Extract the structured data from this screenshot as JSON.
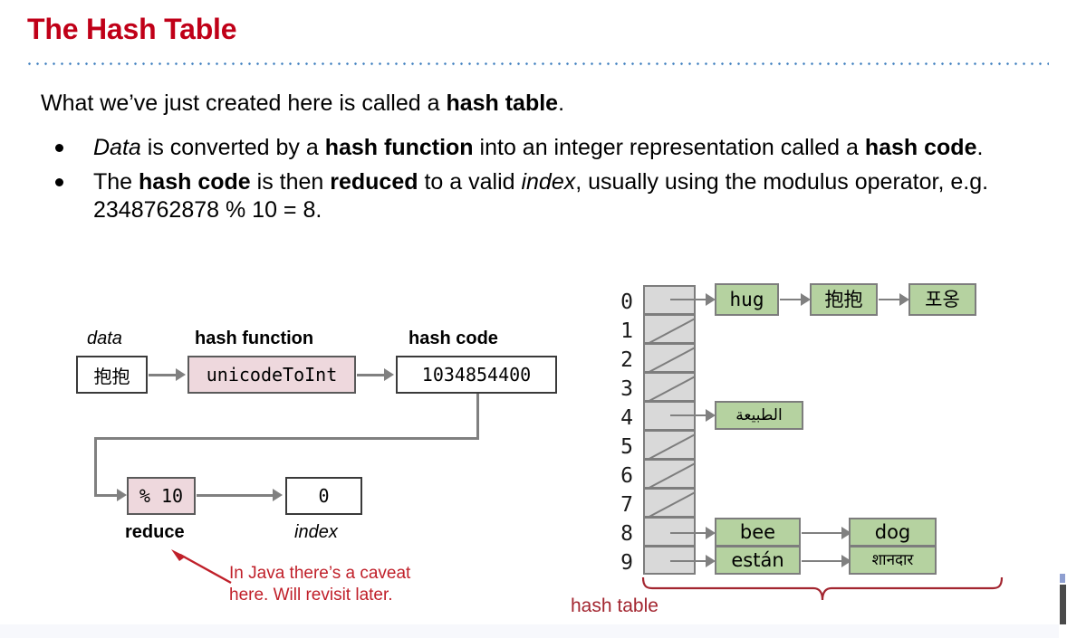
{
  "slide": {
    "title": "The Hash Table",
    "lead": {
      "pre": "What we’ve just created here is called a ",
      "bold": "hash table",
      "post": "."
    },
    "bullets": [
      {
        "seg1_italic": "Data",
        "seg2": " is converted by a ",
        "seg3_bold": "hash function",
        "seg4": " into an integer representation called a ",
        "seg5_bold": "hash code",
        "seg6": "."
      },
      {
        "seg1": "The ",
        "seg2_bold": "hash code",
        "seg3": " is then ",
        "seg4_bold": "reduced",
        "seg5": " to a valid ",
        "seg6_italic": "index",
        "seg7": ", usually using the modulus operator, e.g. 2348762878 % 10 = 8."
      }
    ]
  },
  "flow_diagram": {
    "labels": {
      "data": "data",
      "hash_function": "hash function",
      "hash_code": "hash code",
      "reduce": "reduce",
      "index": "index"
    },
    "boxes": {
      "data_value": "抱抱",
      "hash_function_value": "unicodeToInt",
      "hash_code_value": "1034854400",
      "reduce_value": "% 10",
      "index_value": "0"
    },
    "annotation": {
      "line1": "In Java there’s a caveat",
      "line2": "here. Will revisit later."
    },
    "colors": {
      "pink_fill": "#eed8dd",
      "box_border": "#3a3a3a",
      "arrow": "#808080",
      "annotation_red": "#c0202a"
    }
  },
  "hash_table": {
    "caption": "hash table",
    "indices": [
      "0",
      "1",
      "2",
      "3",
      "4",
      "5",
      "6",
      "7",
      "8",
      "9"
    ],
    "buckets": [
      {
        "index": "0",
        "empty": false,
        "nodes": [
          "hug",
          "抱抱",
          "포옹"
        ]
      },
      {
        "index": "1",
        "empty": true,
        "nodes": []
      },
      {
        "index": "2",
        "empty": true,
        "nodes": []
      },
      {
        "index": "3",
        "empty": true,
        "nodes": []
      },
      {
        "index": "4",
        "empty": false,
        "nodes": [
          "الطبيعة"
        ]
      },
      {
        "index": "5",
        "empty": true,
        "nodes": []
      },
      {
        "index": "6",
        "empty": true,
        "nodes": []
      },
      {
        "index": "7",
        "empty": true,
        "nodes": []
      },
      {
        "index": "8",
        "empty": false,
        "nodes": [
          "bee",
          "dog"
        ]
      },
      {
        "index": "9",
        "empty": false,
        "nodes": [
          "están",
          "शानदार"
        ]
      }
    ],
    "colors": {
      "cell_fill": "#d9d9d9",
      "cell_border": "#7d7d7d",
      "node_fill": "#b5d2a0",
      "brace_red": "#a32630"
    }
  },
  "theme": {
    "title_color": "#c00018",
    "rule_color": "#3f7fbf",
    "background": "#ffffff"
  }
}
